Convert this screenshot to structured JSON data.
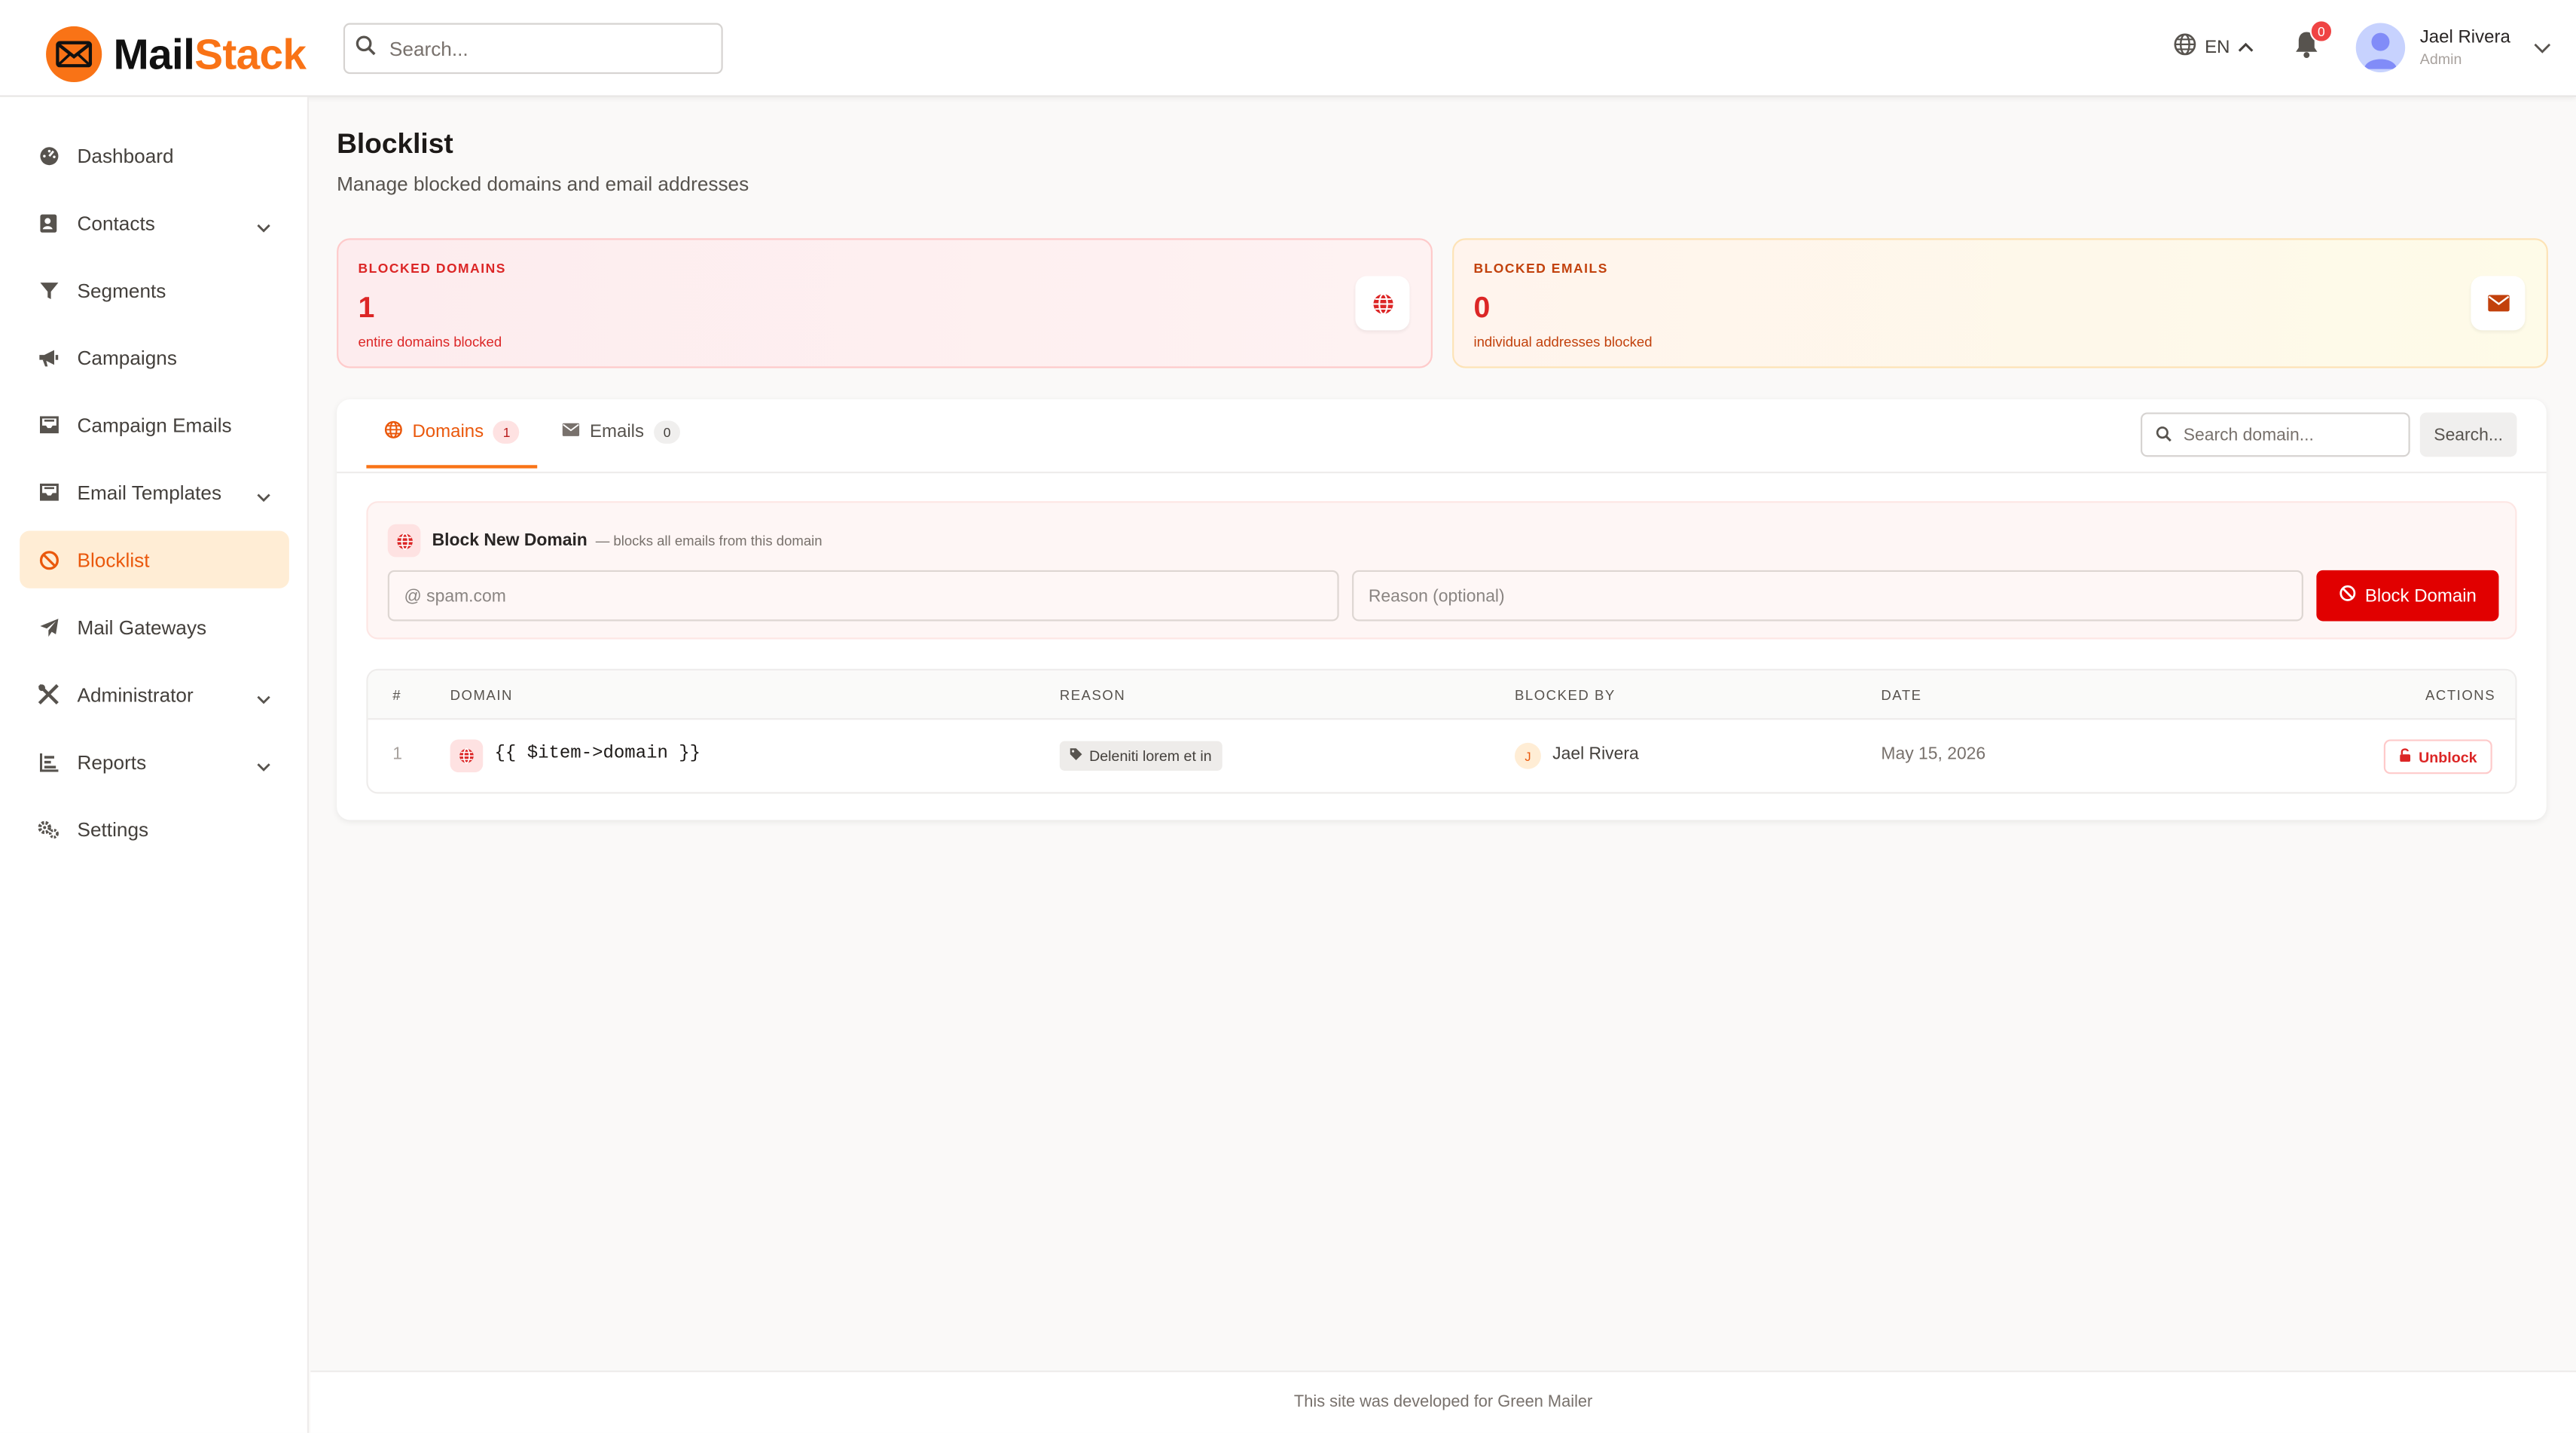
{
  "brand": {
    "part1": "Mail",
    "part2": "Stack",
    "accent_color": "#f97316"
  },
  "header": {
    "search_placeholder": "Search...",
    "language": "EN",
    "notifications_count": "0",
    "user": {
      "name": "Jael Rivera",
      "role": "Admin"
    }
  },
  "sidebar": {
    "items": [
      {
        "label": "Dashboard",
        "icon": "dashboard-icon",
        "has_submenu": false,
        "active": false
      },
      {
        "label": "Contacts",
        "icon": "contacts-icon",
        "has_submenu": true,
        "active": false
      },
      {
        "label": "Segments",
        "icon": "filter-icon",
        "has_submenu": false,
        "active": false
      },
      {
        "label": "Campaigns",
        "icon": "megaphone-icon",
        "has_submenu": false,
        "active": false
      },
      {
        "label": "Campaign Emails",
        "icon": "inbox-icon",
        "has_submenu": false,
        "active": false
      },
      {
        "label": "Email Templates",
        "icon": "template-icon",
        "has_submenu": true,
        "active": false
      },
      {
        "label": "Blocklist",
        "icon": "ban-icon",
        "has_submenu": false,
        "active": true
      },
      {
        "label": "Mail Gateways",
        "icon": "paper-plane-icon",
        "has_submenu": false,
        "active": false
      },
      {
        "label": "Administrator",
        "icon": "tools-icon",
        "has_submenu": true,
        "active": false
      },
      {
        "label": "Reports",
        "icon": "chart-icon",
        "has_submenu": true,
        "active": false
      },
      {
        "label": "Settings",
        "icon": "gears-icon",
        "has_submenu": false,
        "active": false
      }
    ]
  },
  "page": {
    "title": "Blocklist",
    "subtitle": "Manage blocked domains and email addresses"
  },
  "stats": {
    "domains": {
      "label": "BLOCKED DOMAINS",
      "value": "1",
      "note": "entire domains blocked",
      "color": "#dc2626"
    },
    "emails": {
      "label": "BLOCKED EMAILS",
      "value": "0",
      "note": "individual addresses blocked",
      "color": "#c2410c"
    }
  },
  "tabs": [
    {
      "label": "Domains",
      "count": "1",
      "active": true
    },
    {
      "label": "Emails",
      "count": "0",
      "active": false
    }
  ],
  "domain_search": {
    "placeholder": "Search domain...",
    "button": "Search..."
  },
  "block_form": {
    "title": "Block New Domain",
    "hint": "— blocks all emails from this domain",
    "domain_placeholder": "@ spam.com",
    "reason_placeholder": "Reason (optional)",
    "button": "Block Domain",
    "button_color": "#e10000"
  },
  "table": {
    "headers": [
      "#",
      "DOMAIN",
      "REASON",
      "BLOCKED BY",
      "DATE",
      "ACTIONS"
    ],
    "rows": [
      {
        "index": "1",
        "domain": "{{ $item->domain }}",
        "reason": "Deleniti lorem et in",
        "blocked_by": "Jael Rivera",
        "blocked_by_initial": "J",
        "date": "May 15, 2026",
        "action": "Unblock"
      }
    ]
  },
  "footer": {
    "text": "This site was developed for Green Mailer"
  }
}
